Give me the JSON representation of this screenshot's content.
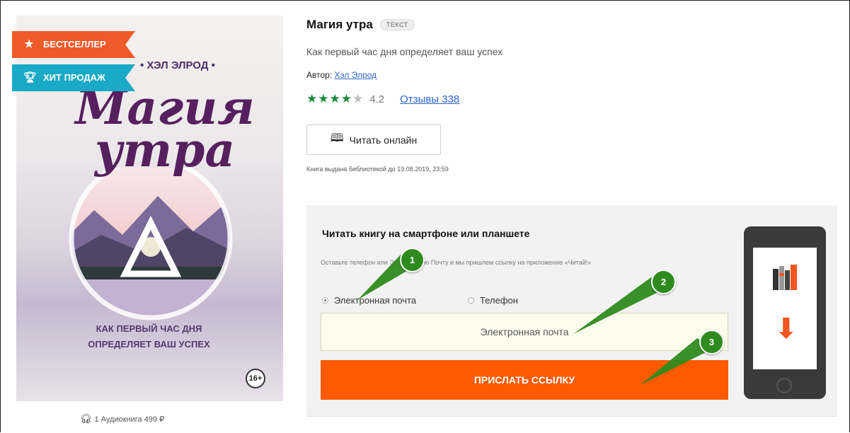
{
  "cover": {
    "author": "• ХЭЛ ЭЛРОД •",
    "title_line1": "Магия",
    "title_line2": "утра",
    "subtitle_line1": "КАК ПЕРВЫЙ ЧАС ДНЯ",
    "subtitle_line2": "ОПРЕДЕЛЯЕТ ВАШ УСПЕХ",
    "age": "16+"
  },
  "badges": {
    "bestseller": "БЕСТСЕЛЛЕР",
    "bestseller_icon": "star-icon",
    "hit": "ХИТ ПРОДАЖ",
    "hit_icon": "trophy-icon"
  },
  "audio": {
    "text": "1 Аудиокнига 499 ₽",
    "icon": "headphones-icon"
  },
  "book": {
    "title": "Магия утра",
    "type": "ТЕКСТ",
    "subtitle": "Как первый час дня определяет ваш успех",
    "author_label": "Автор:",
    "author_name": "Хэл Элрод",
    "rating": "4.2",
    "rating_stars": 4,
    "reviews_label": "Отзывы 338",
    "read_online": "Читать онлайн",
    "issued": "Книга выдана библиотекой до 19.08.2019, 23:59"
  },
  "send_panel": {
    "heading": "Читать книгу на смартфоне или планшете",
    "note": "Оставьте телефон или Электронную Почту и мы пришлем ссылку на приложение «Читай!»",
    "radio_email": "Электронная почта",
    "radio_phone": "Телефон",
    "selected": "email",
    "email_placeholder": "Электронная почта",
    "send_button": "ПРИСЛАТЬ ССЫЛКУ"
  },
  "markers": [
    "1",
    "2",
    "3"
  ],
  "colors": {
    "accent_orange": "#fe5a00",
    "badge_orange": "#ef5a2a",
    "badge_teal": "#1aa9c6",
    "marker_green": "#2f8b1f",
    "link_blue": "#2a64c9",
    "star_green": "#1c8a3c"
  }
}
